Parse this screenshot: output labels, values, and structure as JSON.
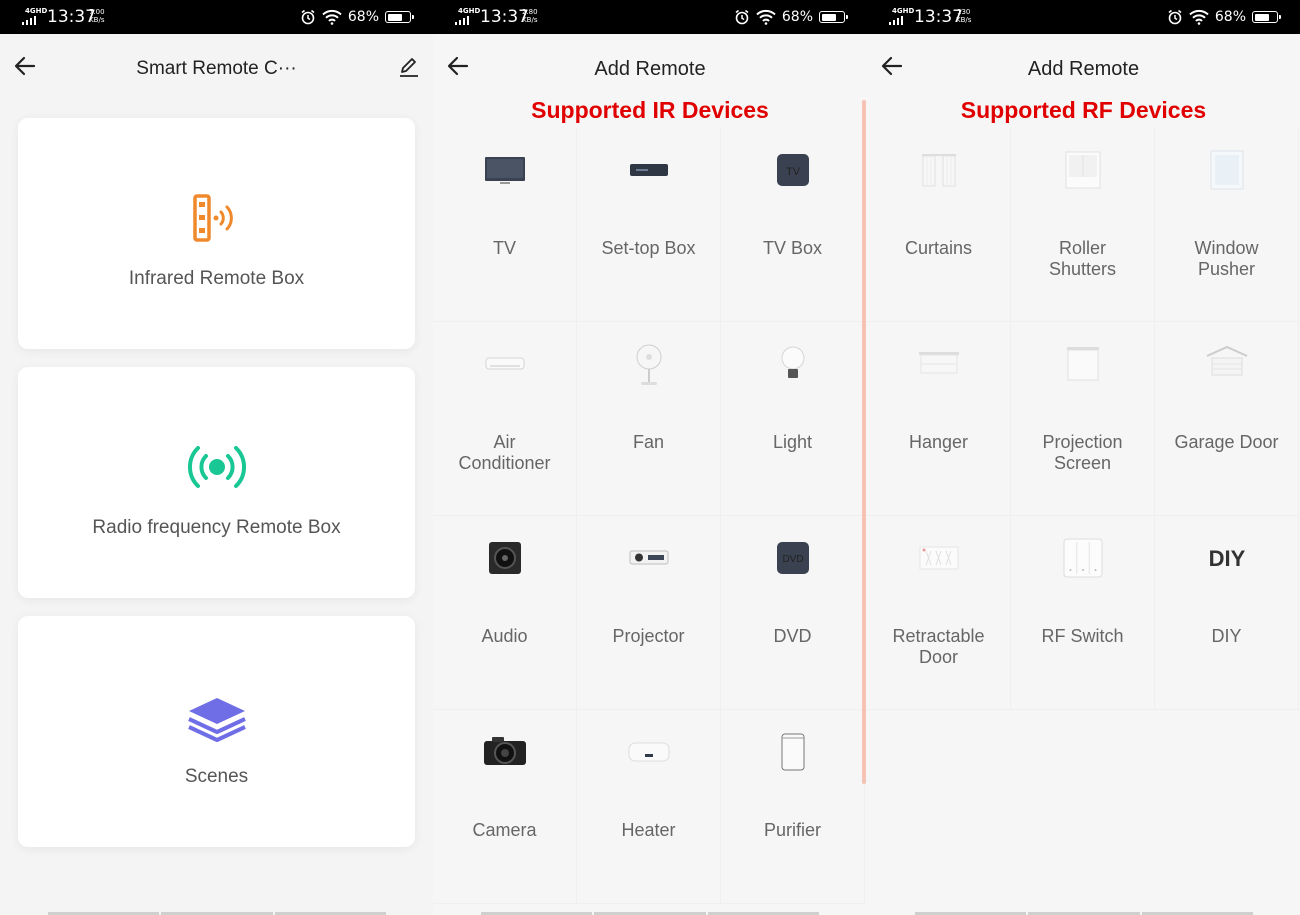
{
  "panels": [
    {
      "status": {
        "time": "13:37",
        "speed_value": "7.00",
        "speed_unit": "KB/s",
        "network": "4GHD",
        "battery": "68%",
        "battery_level": 0.68
      },
      "title": "Smart Remote C···",
      "cards": [
        {
          "label": "Infrared Remote Box",
          "icon": "infrared-box-icon",
          "color": "#f0892b"
        },
        {
          "label": "Radio frequency Remote Box",
          "icon": "rf-signal-icon",
          "color": "#19c794"
        },
        {
          "label": "Scenes",
          "icon": "layers-icon",
          "color": "#6f6ee6"
        }
      ]
    },
    {
      "status": {
        "time": "13:37",
        "speed_value": "2.80",
        "speed_unit": "KB/s",
        "network": "4GHD",
        "battery": "68%",
        "battery_level": 0.68
      },
      "title": "Add Remote",
      "heading": "Supported IR Devices",
      "devices": [
        {
          "label": "TV",
          "icon": "tv-icon"
        },
        {
          "label": "Set-top Box",
          "icon": "set-top-box-icon"
        },
        {
          "label": "TV Box",
          "icon": "tv-box-icon",
          "glyph": "TV"
        },
        {
          "label": "Air\nConditioner",
          "icon": "air-conditioner-icon"
        },
        {
          "label": "Fan",
          "icon": "fan-icon"
        },
        {
          "label": "Light",
          "icon": "light-bulb-icon"
        },
        {
          "label": "Audio",
          "icon": "speaker-icon"
        },
        {
          "label": "Projector",
          "icon": "projector-icon"
        },
        {
          "label": "DVD",
          "icon": "dvd-icon",
          "glyph": "DVD"
        },
        {
          "label": "Camera",
          "icon": "camera-icon"
        },
        {
          "label": "Heater",
          "icon": "water-heater-icon"
        },
        {
          "label": "Purifier",
          "icon": "air-purifier-icon"
        }
      ]
    },
    {
      "status": {
        "time": "13:37",
        "speed_value": "130",
        "speed_unit": "KB/s",
        "network": "4GHD",
        "battery": "68%",
        "battery_level": 0.68
      },
      "title": "Add Remote",
      "heading": "Supported RF Devices",
      "devices": [
        {
          "label": "Curtains",
          "icon": "curtains-icon"
        },
        {
          "label": "Roller\nShutters",
          "icon": "roller-shutters-icon"
        },
        {
          "label": "Window\nPusher",
          "icon": "window-pusher-icon"
        },
        {
          "label": "Hanger",
          "icon": "clothes-hanger-icon"
        },
        {
          "label": "Projection\nScreen",
          "icon": "projection-screen-icon"
        },
        {
          "label": "Garage Door",
          "icon": "garage-door-icon"
        },
        {
          "label": "Retractable\nDoor",
          "icon": "retractable-door-icon"
        },
        {
          "label": "RF Switch",
          "icon": "rf-switch-icon"
        },
        {
          "label": "DIY",
          "icon": "diy-icon",
          "glyph": "DIY"
        }
      ]
    }
  ]
}
